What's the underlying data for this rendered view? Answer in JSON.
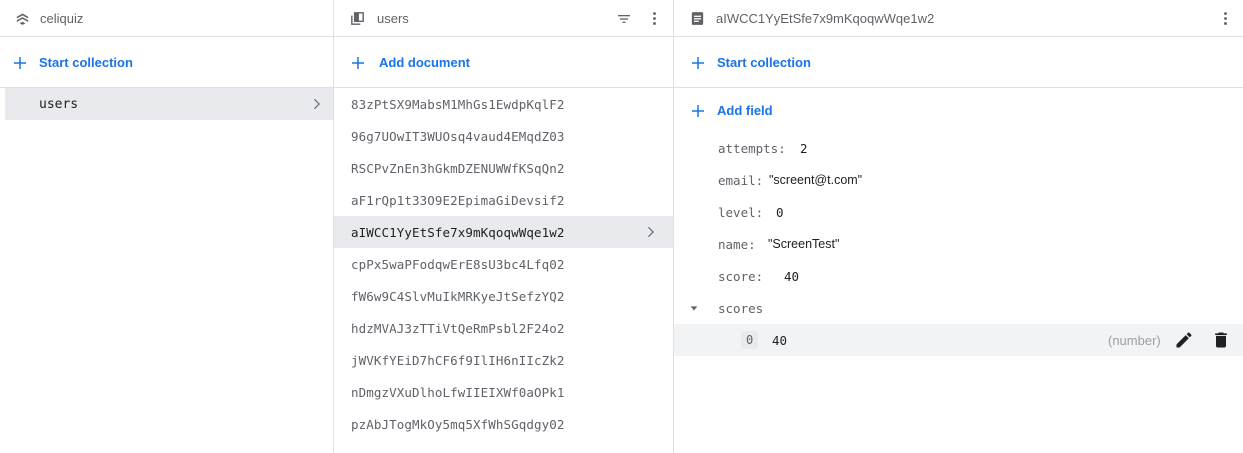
{
  "panel1": {
    "title": "celiquiz",
    "add_label": "Start collection",
    "collections": [
      {
        "label": "users"
      }
    ]
  },
  "panel2": {
    "title": "users",
    "add_label": "Add document",
    "documents": [
      "83zPtSX9MabsM1MhGs1EwdpKqlF2",
      "96g7UOwIT3WUOsq4vaud4EMqdZ03",
      "RSCPvZnEn3hGkmDZENUWWfKSqQn2",
      "aF1rQp1t33O9E2EpimaGiDevsif2",
      "aIWCC1YyEtSfe7x9mKqoqwWqe1w2",
      "cpPx5waPFodqwErE8sU3bc4Lfq02",
      "fW6w9C4SlvMuIkMRKyeJtSefzYQ2",
      "hdzMVAJ3zTTiVtQeRmPsbl2F24o2",
      "jWVKfYEiD7hCF6f9IlIH6nIIcZk2",
      "nDmgzVXuDlhoLfwIIEIXWf0aOPk1",
      "pzAbJTogMkOy5mq5XfWhSGqdgy02"
    ],
    "selected_index": 4
  },
  "panel3": {
    "title": "aIWCC1YyEtSfe7x9mKqoqwWqe1w2",
    "start_collection_label": "Start collection",
    "add_field_label": "Add field",
    "fields": {
      "attempts_key": "attempts:",
      "attempts_val": "2",
      "email_key": "email:",
      "email_val": "\"screent@t.com\"",
      "level_key": "level:",
      "level_val": "0",
      "name_key": "name:",
      "name_val": "\"ScreenTest\"",
      "score_key": "score:",
      "score_val": "40",
      "scores_key": "scores"
    },
    "array_item": {
      "index": "0",
      "value": "40",
      "type": "(number)"
    }
  },
  "colors": {
    "accent": "#1a73e8",
    "selected_bg": "#e8eaed",
    "border": "#e0e0e0",
    "muted_text": "#5f6368"
  },
  "icons": {
    "panel1": "firestore-database-icon",
    "panel2": "collection-icon",
    "panel3": "document-icon",
    "filter": "filter-icon",
    "more": "more-vert-icon",
    "add": "plus-icon",
    "chevron": "chevron-right-icon",
    "expand": "caret-down-icon",
    "edit": "pencil-icon",
    "delete": "trash-icon"
  }
}
